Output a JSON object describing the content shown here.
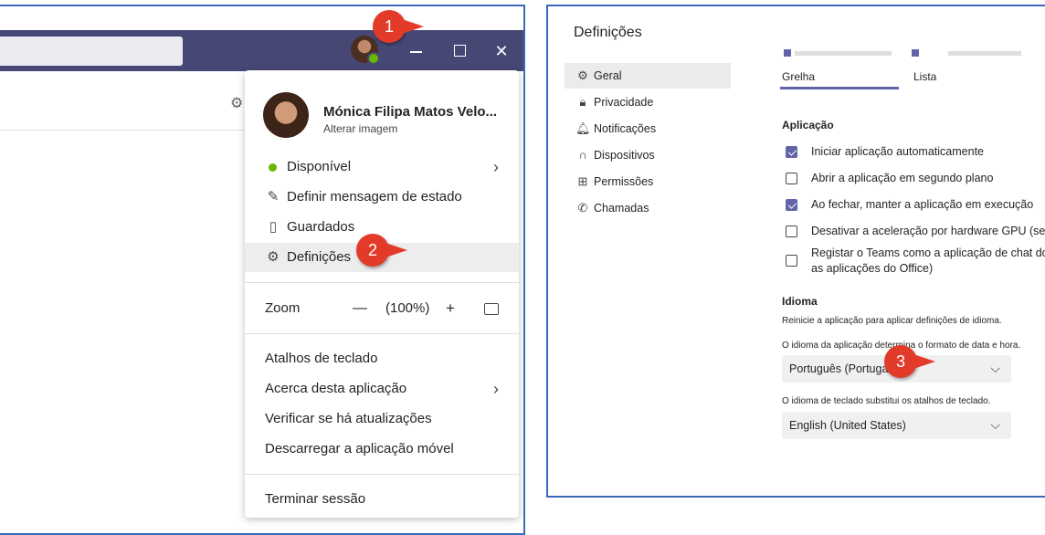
{
  "badges": [
    "1",
    "2",
    "3"
  ],
  "window_controls": {
    "close": "✕"
  },
  "menu": {
    "profile_name": "Mónica Filipa Matos Velo...",
    "change_image": "Alterar imagem",
    "status": "Disponível",
    "set_status_message": "Definir mensagem de estado",
    "saved": "Guardados",
    "settings": "Definições",
    "zoom_label": "Zoom",
    "zoom_minus": "—",
    "zoom_value": "(100%)",
    "zoom_plus": "+",
    "keyboard_shortcuts": "Atalhos de teclado",
    "about": "Acerca desta aplicação",
    "check_updates": "Verificar se há atualizações",
    "download_mobile": "Descarregar a aplicação móvel",
    "sign_out": "Terminar sessão"
  },
  "settings": {
    "title": "Definições",
    "nav": [
      "Geral",
      "Privacidade",
      "Notificações",
      "Dispositivos",
      "Permissões",
      "Chamadas"
    ],
    "layout_grid": "Grelha",
    "layout_list": "Lista",
    "app_section": "Aplicação",
    "checkboxes": [
      {
        "label": "Iniciar aplicação automaticamente",
        "checked": true
      },
      {
        "label": "Abrir a aplicação em segundo plano",
        "checked": false
      },
      {
        "label": "Ao fechar, manter a aplicação em execução",
        "checked": true
      },
      {
        "label": "Desativar a aceleração por hardware GPU (sera",
        "checked": false
      },
      {
        "label": "Registar o Teams como a aplicação de chat do",
        "label2": "as aplicações do Office)",
        "checked": false
      }
    ],
    "language_section": "Idioma",
    "restart_note": "Reinicie a aplicação para aplicar definições de idioma.",
    "app_lang_note": "O idioma da aplicação determina o formato de data e hora.",
    "app_lang_value": "Português (Portugal)",
    "keyboard_lang_note": "O idioma de teclado substitui os atalhos de teclado.",
    "keyboard_lang_value": "English (United States)"
  },
  "colors": {
    "titlebar": "#464775",
    "accent": "#6264a7",
    "badge": "#e23b2a",
    "status_green": "#6bb700"
  }
}
